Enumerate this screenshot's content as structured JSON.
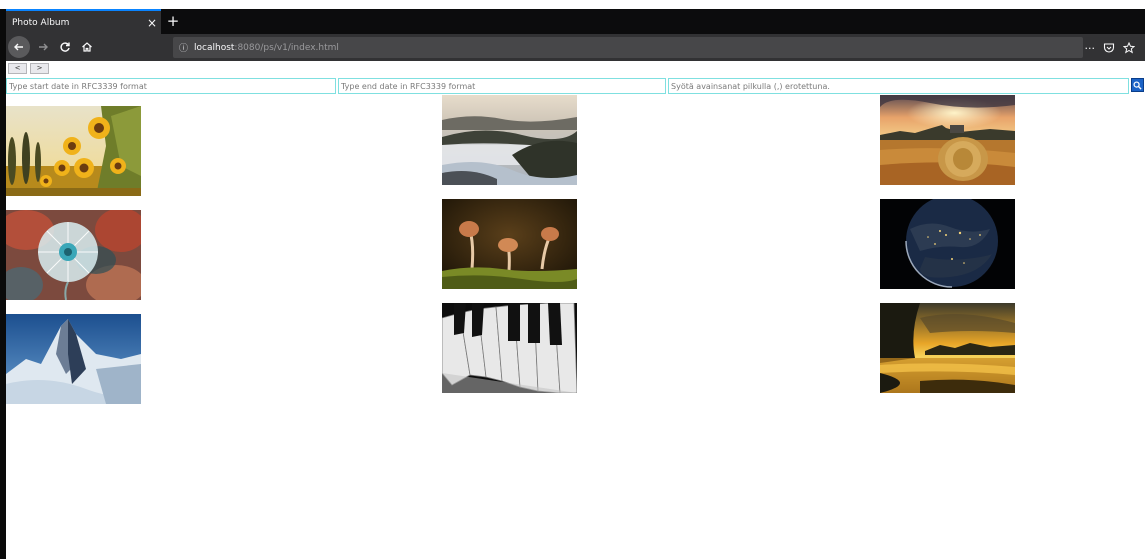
{
  "browser": {
    "tab_title": "Photo Album",
    "tab_close": "×",
    "new_tab": "+",
    "url_info": "ⓘ",
    "url_host": "localhost",
    "url_path": ":8080/ps/v1/index.html",
    "menu_icon": "···"
  },
  "pager": {
    "prev_label": "<",
    "next_label": ">"
  },
  "filters": {
    "start_placeholder": "Type start date in RFC3339 format",
    "end_placeholder": "Type end date in RFC3339 format",
    "keywords_placeholder": "Syötä avainsanat pilkulla (,) erotettuna."
  },
  "photos": [
    "sunflowers",
    "misty-valley",
    "hay-bale-sunset",
    "dandelion",
    "mushrooms",
    "earth-at-night",
    "matterhorn",
    "piano-keys",
    "lake-sunset"
  ]
}
